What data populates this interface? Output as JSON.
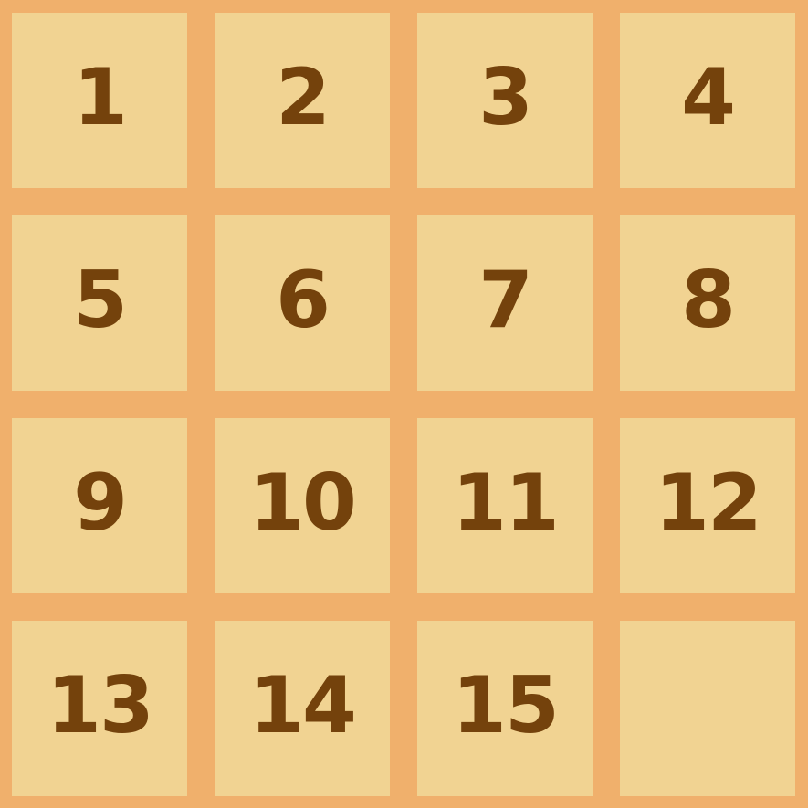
{
  "puzzle": {
    "tiles": [
      {
        "label": "1"
      },
      {
        "label": "2"
      },
      {
        "label": "3"
      },
      {
        "label": "4"
      },
      {
        "label": "5"
      },
      {
        "label": "6"
      },
      {
        "label": "7"
      },
      {
        "label": "8"
      },
      {
        "label": "9"
      },
      {
        "label": "10"
      },
      {
        "label": "11"
      },
      {
        "label": "12"
      },
      {
        "label": "13"
      },
      {
        "label": "14"
      },
      {
        "label": "15"
      },
      {
        "label": ""
      }
    ]
  },
  "colors": {
    "board_background": "#f0b06c",
    "tile_background": "#f1d392",
    "tile_text": "#74420c"
  }
}
